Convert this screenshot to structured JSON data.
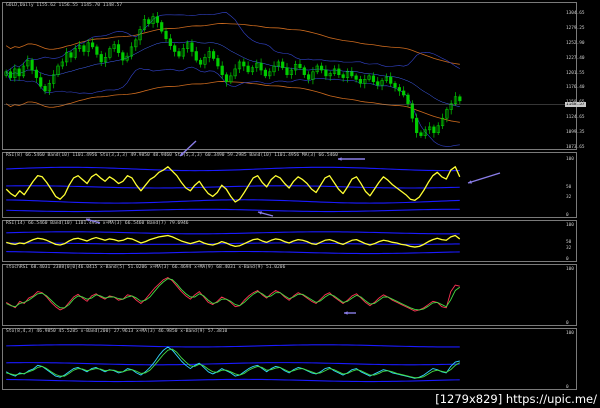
{
  "chart_data": [
    {
      "type": "candlestick",
      "title": "GOLD,Daily  1155.62 1156.55 1145.70 1148.57",
      "ytick_labels": [
        "1304.65",
        "1279.25",
        "1252.90",
        "1227.40",
        "1201.55",
        "1176.40",
        "1150.65",
        "1124.65",
        "1099.35",
        "1073.65"
      ],
      "last_price_label": "1148.57",
      "close": [
        1205,
        1195,
        1210,
        1198,
        1215,
        1225,
        1208,
        1195,
        1180,
        1172,
        1185,
        1200,
        1215,
        1222,
        1238,
        1230,
        1245,
        1250,
        1240,
        1255,
        1248,
        1235,
        1222,
        1230,
        1245,
        1252,
        1238,
        1225,
        1232,
        1248,
        1260,
        1278,
        1295,
        1288,
        1300,
        1290,
        1275,
        1262,
        1250,
        1240,
        1232,
        1245,
        1255,
        1240,
        1225,
        1218,
        1230,
        1240,
        1228,
        1215,
        1200,
        1188,
        1198,
        1210,
        1222,
        1215,
        1205,
        1212,
        1220,
        1208,
        1198,
        1205,
        1215,
        1222,
        1212,
        1200,
        1208,
        1218,
        1212,
        1200,
        1192,
        1205,
        1215,
        1208,
        1198,
        1202,
        1210,
        1200,
        1195,
        1205,
        1198,
        1192,
        1185,
        1192,
        1198,
        1188,
        1182,
        1190,
        1196,
        1185,
        1178,
        1172,
        1165,
        1150,
        1125,
        1100,
        1095,
        1105,
        1110,
        1100,
        1112,
        1125,
        1140,
        1150,
        1162,
        1155
      ]
    },
    {
      "type": "line",
      "title": "RSI(8) 66.5460  Band(10) 1101.4956  Sto(3,3,3) 49.9850 48.9460  Sto(5,3,3) 60.3490 59.2985  Band(10) 1101.4956  MA(3) 66.5460",
      "ytick_labels": [
        "100",
        "50",
        "32",
        "0"
      ],
      "series": [
        {
          "values": [
            48,
            40,
            35,
            45,
            38,
            50,
            62,
            72,
            70,
            60,
            48,
            35,
            30,
            38,
            55,
            68,
            72,
            65,
            58,
            70,
            75,
            68,
            62,
            70,
            65,
            58,
            62,
            72,
            68,
            55,
            45,
            55,
            65,
            70,
            78,
            82,
            88,
            80,
            72,
            60,
            50,
            45,
            55,
            62,
            50,
            40,
            35,
            42,
            55,
            48,
            35,
            25,
            30,
            42,
            55,
            68,
            72,
            60,
            52,
            65,
            72,
            68,
            58,
            50,
            62,
            70,
            65,
            58,
            48,
            42,
            55,
            68,
            72,
            60,
            48,
            40,
            52,
            66,
            70,
            58,
            44,
            36,
            48,
            60,
            70,
            64,
            56,
            50,
            44,
            38,
            30,
            28,
            34,
            46,
            60,
            72,
            78,
            70,
            66,
            82,
            88,
            70
          ]
        }
      ]
    },
    {
      "type": "line",
      "title": "RSI(14) 66.5460  Band(10) 1101.4956  x+MA(3) 66.5460  Band(7) 79.6946",
      "ytick_labels": [
        "100",
        "50",
        "32",
        "0"
      ],
      "series": [
        {
          "values": [
            52,
            48,
            46,
            50,
            48,
            54,
            60,
            64,
            62,
            58,
            52,
            46,
            44,
            48,
            56,
            62,
            64,
            60,
            56,
            62,
            66,
            62,
            58,
            62,
            60,
            56,
            58,
            64,
            62,
            56,
            50,
            54,
            60,
            64,
            68,
            70,
            72,
            68,
            62,
            56,
            52,
            48,
            52,
            56,
            50,
            46,
            44,
            48,
            54,
            50,
            44,
            40,
            42,
            48,
            54,
            60,
            62,
            56,
            52,
            58,
            62,
            60,
            54,
            50,
            56,
            60,
            58,
            54,
            48,
            46,
            52,
            58,
            60,
            56,
            50,
            46,
            52,
            58,
            60,
            54,
            48,
            44,
            48,
            54,
            58,
            56,
            52,
            50,
            46,
            44,
            40,
            38,
            40,
            46,
            54,
            60,
            64,
            60,
            58,
            68,
            72,
            62
          ]
        }
      ]
    },
    {
      "type": "line",
      "title": "stochRSI 68.4031 2388|0|0|46.0415  x-Band(5) 51.0206  x+MA(3) 66.4694  x+MA(9) 68.4031  x-Band(9) 51.0206",
      "ytick_labels": [
        "100",
        "0"
      ],
      "series": [
        {
          "values": [
            40,
            35,
            30,
            42,
            38,
            48,
            52,
            60,
            58,
            50,
            40,
            32,
            26,
            30,
            40,
            50,
            55,
            48,
            42,
            52,
            56,
            50,
            46,
            52,
            50,
            44,
            46,
            54,
            52,
            44,
            38,
            46,
            56,
            66,
            74,
            82,
            86,
            80,
            70,
            60,
            52,
            46,
            54,
            60,
            50,
            40,
            36,
            42,
            50,
            46,
            40,
            32,
            34,
            44,
            52,
            58,
            62,
            54,
            48,
            56,
            62,
            58,
            50,
            44,
            52,
            58,
            54,
            48,
            42,
            38,
            46,
            54,
            58,
            50,
            44,
            38,
            44,
            52,
            56,
            48,
            40,
            34,
            40,
            48,
            54,
            50,
            44,
            40,
            36,
            32,
            28,
            24,
            26,
            30,
            36,
            42,
            40,
            32,
            30,
            60,
            72,
            70
          ]
        },
        {
          "values": [
            38,
            34,
            32,
            38,
            40,
            44,
            50,
            56,
            57,
            52,
            44,
            36,
            30,
            30,
            36,
            46,
            52,
            50,
            46,
            48,
            54,
            52,
            48,
            50,
            50,
            47,
            46,
            50,
            52,
            48,
            42,
            44,
            50,
            60,
            70,
            78,
            84,
            82,
            74,
            64,
            56,
            50,
            50,
            56,
            52,
            44,
            38,
            40,
            46,
            46,
            42,
            36,
            34,
            40,
            48,
            55,
            60,
            56,
            50,
            52,
            58,
            58,
            52,
            47,
            50,
            55,
            55,
            50,
            45,
            40,
            43,
            50,
            55,
            52,
            46,
            40,
            42,
            48,
            53,
            50,
            43,
            37,
            38,
            44,
            50,
            50,
            46,
            42,
            38,
            34,
            30,
            27,
            26,
            28,
            33,
            39,
            40,
            36,
            32,
            45,
            62,
            68
          ]
        }
      ]
    },
    {
      "type": "line",
      "title": "Sto(8,4,3) 46.9850 45.5285  x-Band(200) 27.9613  x+MA(3) 46.9850  x-Band(9) 57.3810",
      "ytick_labels": [
        "100",
        "0"
      ],
      "series": [
        {
          "values": [
            30,
            25,
            22,
            28,
            26,
            32,
            35,
            42,
            40,
            34,
            28,
            22,
            20,
            24,
            30,
            36,
            38,
            34,
            30,
            36,
            38,
            34,
            30,
            34,
            32,
            28,
            30,
            36,
            34,
            28,
            24,
            30,
            38,
            48,
            60,
            70,
            76,
            70,
            60,
            50,
            42,
            36,
            42,
            46,
            38,
            30,
            26,
            30,
            36,
            32,
            28,
            22,
            24,
            30,
            36,
            40,
            42,
            36,
            30,
            36,
            40,
            38,
            32,
            28,
            34,
            38,
            36,
            32,
            28,
            26,
            30,
            36,
            38,
            32,
            28,
            24,
            28,
            34,
            36,
            30,
            26,
            22,
            26,
            30,
            34,
            32,
            28,
            26,
            24,
            22,
            20,
            18,
            20,
            24,
            30,
            36,
            34,
            30,
            28,
            40,
            48,
            50
          ]
        },
        {
          "values": [
            28,
            26,
            24,
            26,
            27,
            30,
            33,
            38,
            40,
            36,
            30,
            25,
            22,
            22,
            27,
            33,
            36,
            35,
            32,
            34,
            36,
            35,
            32,
            33,
            33,
            30,
            30,
            33,
            34,
            31,
            27,
            28,
            33,
            42,
            52,
            62,
            70,
            72,
            66,
            56,
            48,
            41,
            40,
            44,
            41,
            35,
            30,
            29,
            33,
            33,
            30,
            26,
            24,
            27,
            33,
            37,
            40,
            38,
            33,
            34,
            37,
            38,
            34,
            30,
            32,
            35,
            36,
            33,
            30,
            27,
            28,
            32,
            36,
            34,
            30,
            26,
            27,
            31,
            34,
            32,
            28,
            24,
            24,
            27,
            31,
            32,
            30,
            27,
            25,
            23,
            21,
            19,
            19,
            21,
            26,
            31,
            33,
            31,
            29,
            34,
            42,
            47
          ]
        }
      ]
    }
  ],
  "footer": {
    "watermark": "[1279x829] https://upic.me/"
  },
  "colors": {
    "background": "#000000",
    "candle_up": "#00cc00",
    "candle_down": "#00cc00",
    "rsi_line": "#ffff33",
    "band_blue": "#1a1aff",
    "arrow": "#8a7de8",
    "stoch_red": "#ff3355",
    "stoch_green": "#44dd44",
    "sto_cyan": "#33d6ff",
    "ma_orange": "#cc6a1e",
    "text": "#cfcfcf"
  }
}
